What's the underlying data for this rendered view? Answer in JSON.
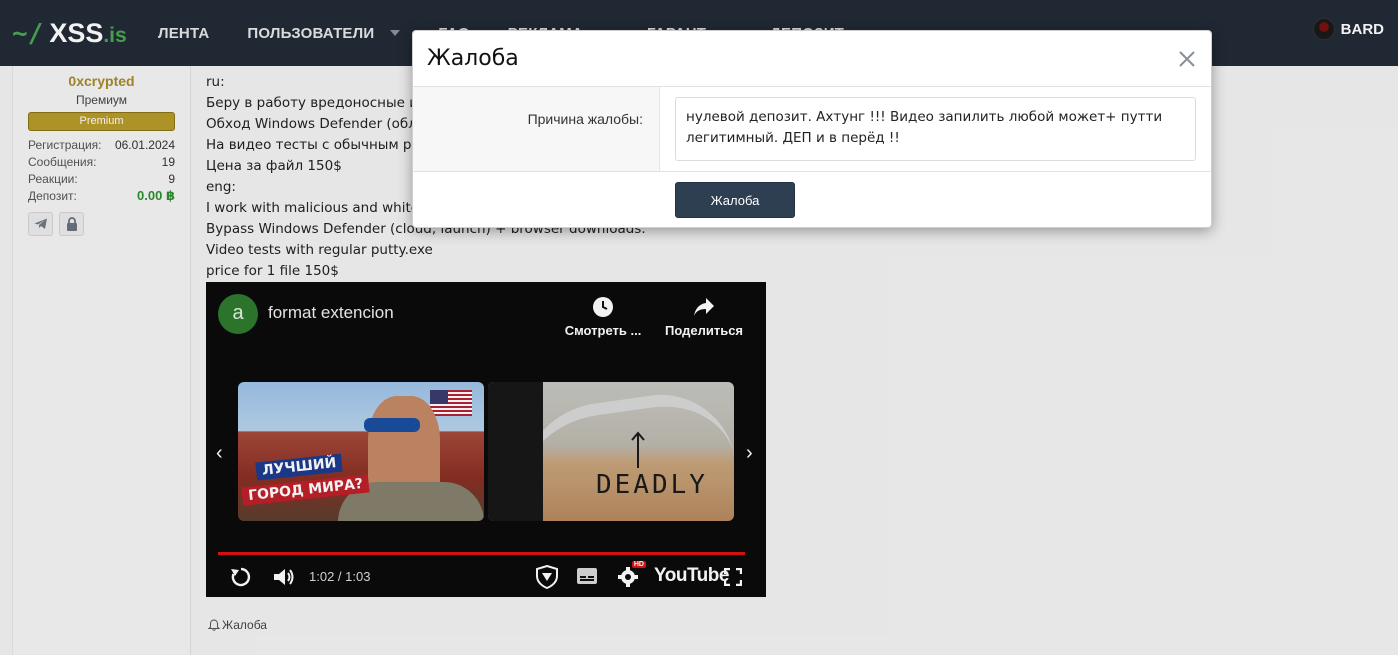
{
  "nav": {
    "logo_prefix": "~/",
    "logo_main": "XSS",
    "logo_tld": ".is",
    "items": [
      {
        "label": "ЛЕНТА",
        "dropdown": false
      },
      {
        "label": "ПОЛЬЗОВАТЕЛИ",
        "dropdown": true
      },
      {
        "label": "FAQ",
        "dropdown": false
      },
      {
        "label": "РЕКЛАМА",
        "dropdown": true
      },
      {
        "label": "ГАРАНТ",
        "dropdown": true
      },
      {
        "label": "ДЕПОЗИТ",
        "dropdown": false
      }
    ],
    "user": "BARD"
  },
  "profile": {
    "username": "0xcrypted",
    "title": "Премиум",
    "badge": "Premium",
    "stats": [
      {
        "key": "Регистрация:",
        "value": "06.01.2024"
      },
      {
        "key": "Сообщения:",
        "value": "19"
      },
      {
        "key": "Реакции:",
        "value": "9"
      },
      {
        "key": "Депозит:",
        "value": "0.00 ฿"
      }
    ],
    "icons": [
      "telegram-icon",
      "lock-icon"
    ]
  },
  "post": {
    "lines": [
      "ru:",
      "Беру в работу вредоносные и",
      "Обход Windows Defender (обл",
      "На видео тесты с обычным pu",
      "Цена за файл 150$",
      "eng:",
      "I work with malicious and white",
      "Bypass Windows Defender (cloud, launch) + browser downloads.",
      "Video tests with regular putty.exe",
      "price for 1 file 150$"
    ]
  },
  "video": {
    "channel_initial": "a",
    "title": "format extencion",
    "watch_label": "Смотреть ...",
    "share_label": "Поделиться",
    "thumb1_line1": "ЛУЧШИЙ",
    "thumb1_line2": "ГОРОД МИРА?",
    "thumb2_text": "DEADLY",
    "time": "1:02 / 1:03",
    "progress": 0.984,
    "brand": "YouTube",
    "quality_badge": "HD"
  },
  "footer": {
    "report_label": "Жалоба"
  },
  "modal": {
    "title": "Жалоба",
    "reason_label": "Причина жалобы:",
    "reason_value": "нулевой депозит. Ахтунг !!! Видео запилить любой может+ путти легитимный. ДЕП и в перёд !!",
    "submit_label": "Жалоба"
  }
}
